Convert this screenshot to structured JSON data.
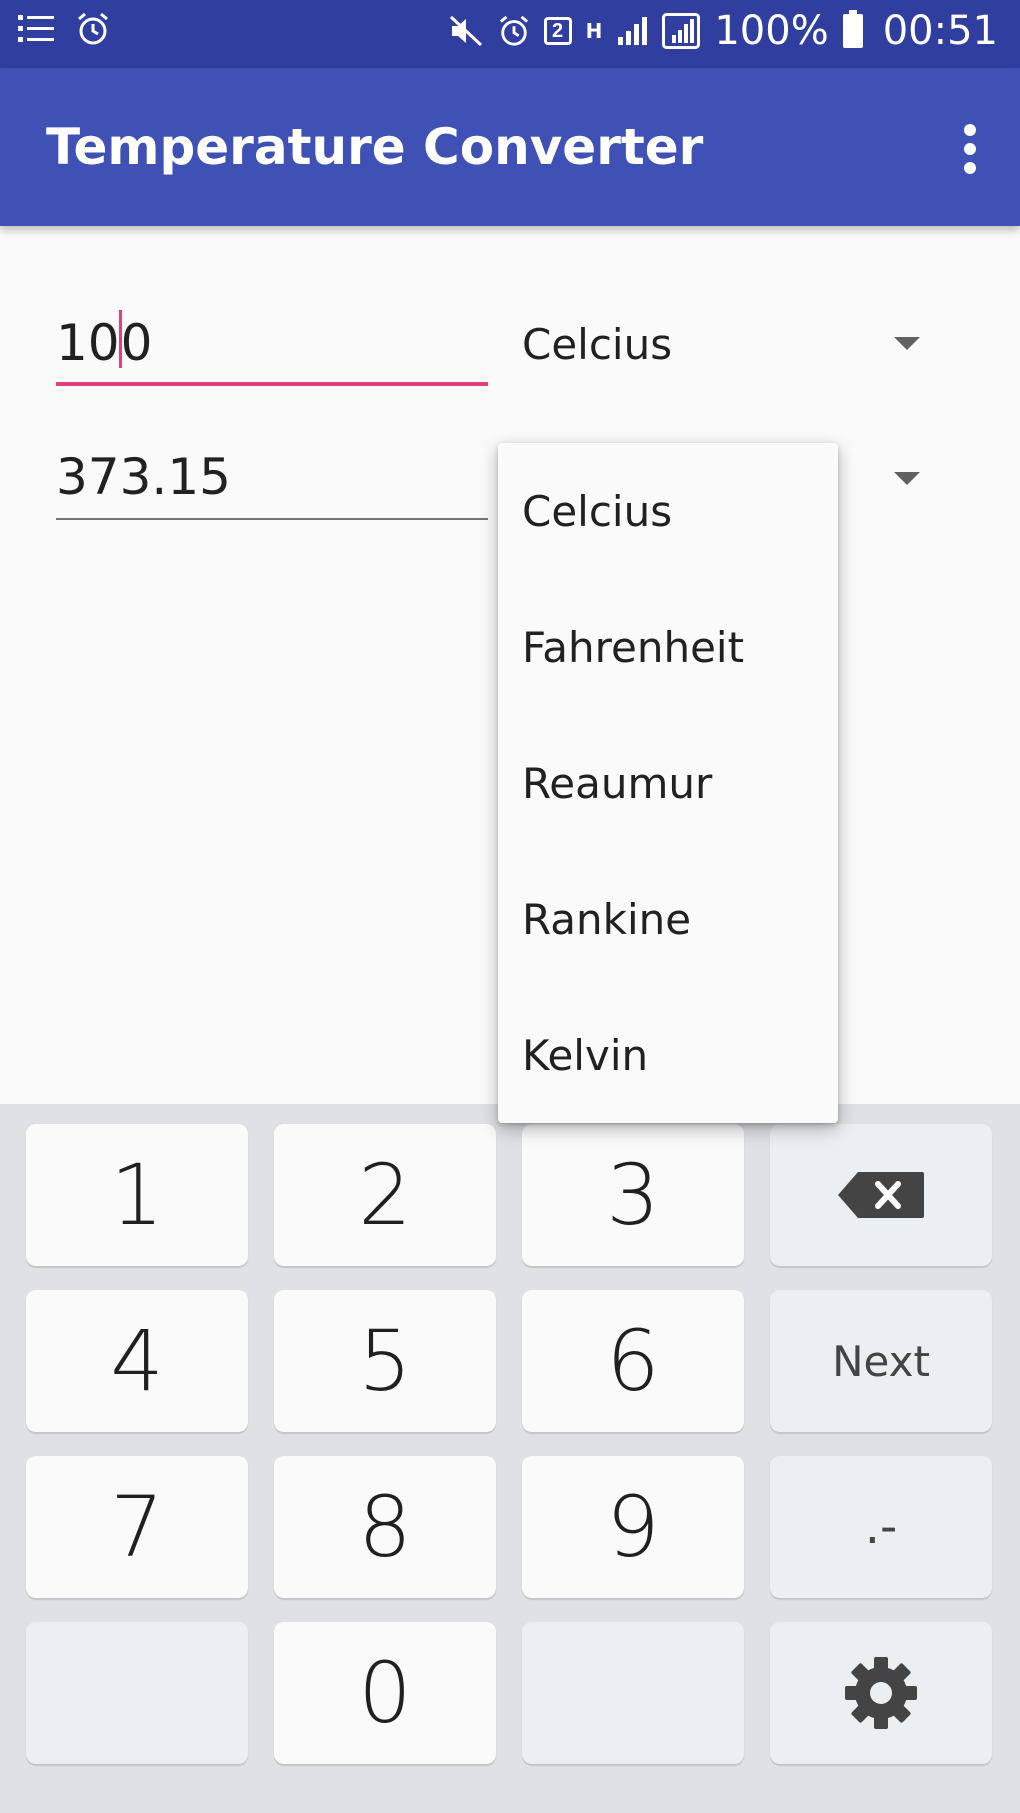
{
  "status_bar": {
    "battery": "100%",
    "time": "00:51",
    "icons": [
      "notification-list-icon",
      "alarm-icon",
      "mute-icon",
      "alarm-icon",
      "sim2-icon",
      "network-h-icon",
      "signal-icon",
      "signal-icon",
      "battery-icon"
    ],
    "sim_label": "2",
    "network_label": "H"
  },
  "app_bar": {
    "title": "Temperature Converter",
    "menu_icon": "more-vert-icon"
  },
  "converter": {
    "input_before_cursor": "10",
    "input_after_cursor": "0",
    "input_unit": "Celcius",
    "output_value": "373.15"
  },
  "dropdown": {
    "options": [
      "Celcius",
      "Fahrenheit",
      "Reaumur",
      "Rankine",
      "Kelvin"
    ]
  },
  "keyboard": {
    "keys": [
      "1",
      "2",
      "3",
      "4",
      "5",
      "6",
      "7",
      "8",
      "9",
      "0"
    ],
    "next_label": "Next",
    "symbol_label": ".-",
    "backspace_icon": "backspace-icon",
    "settings_icon": "gear-icon"
  },
  "colors": {
    "status_bar": "#303f9f",
    "app_bar": "#3f51b5",
    "accent": "#e0417a",
    "keyboard_bg": "#dfe1e4"
  }
}
